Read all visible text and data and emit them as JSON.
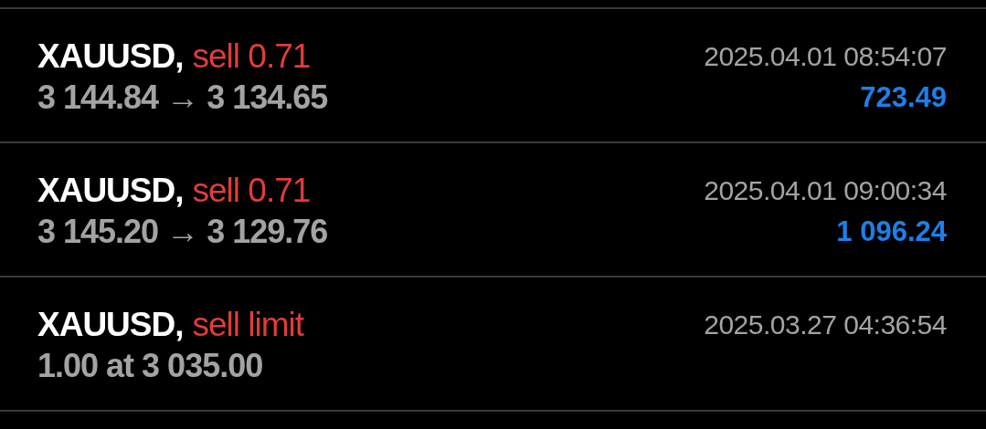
{
  "trades": [
    {
      "symbol": "XAUUSD,",
      "type": "sell 0.71",
      "time": "2025.04.01 08:54:07",
      "prices": "3 144.84 → 3 134.65",
      "profit": "723.49"
    },
    {
      "symbol": "XAUUSD,",
      "type": "sell 0.71",
      "time": "2025.04.01 09:00:34",
      "prices": "3 145.20 → 3 129.76",
      "profit": "1 096.24"
    },
    {
      "symbol": "XAUUSD,",
      "type": "sell limit",
      "time": "2025.03.27 04:36:54",
      "prices": "1.00 at 3 035.00"
    }
  ]
}
